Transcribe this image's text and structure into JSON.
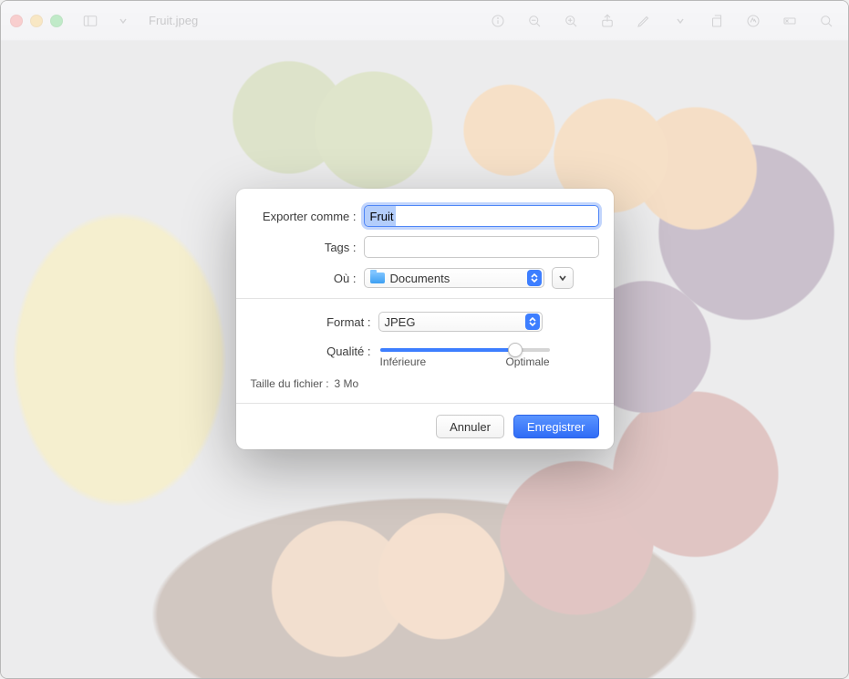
{
  "window": {
    "title": "Fruit.jpeg"
  },
  "export": {
    "label_export_as": "Exporter comme :",
    "filename": "Fruit",
    "label_tags": "Tags :",
    "tags": "",
    "label_where": "Où :",
    "where_folder": "Documents",
    "label_format": "Format :",
    "format_value": "JPEG",
    "label_quality": "Qualité :",
    "quality_percent": 80,
    "quality_min_label": "Inférieure",
    "quality_max_label": "Optimale",
    "label_filesize": "Taille du fichier :",
    "filesize_value": "3 Mo",
    "btn_cancel": "Annuler",
    "btn_save": "Enregistrer"
  }
}
